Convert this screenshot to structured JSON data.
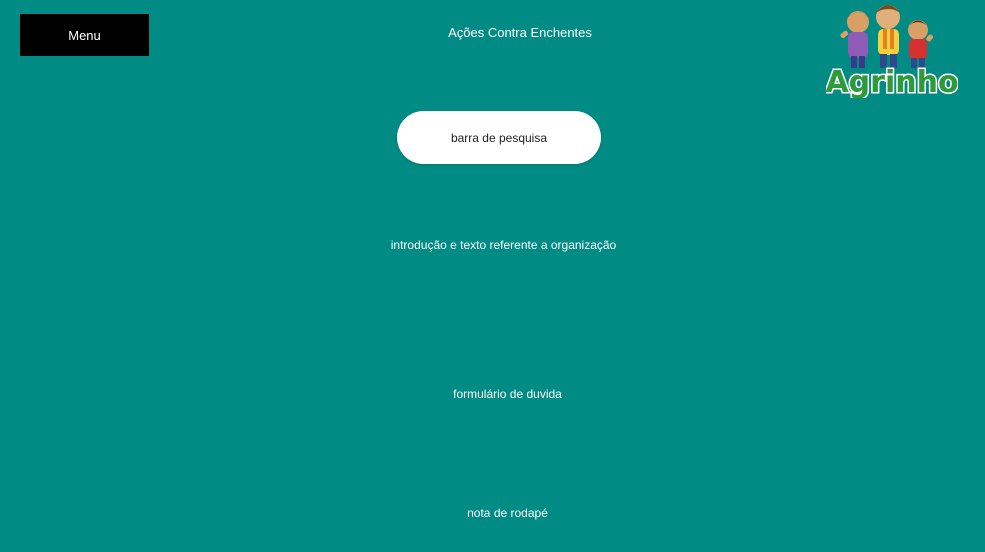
{
  "header": {
    "menu_label": "Menu",
    "title": "Ações Contra Enchentes",
    "logo_text": "Agrinho"
  },
  "search": {
    "placeholder": "barra de pesquisa"
  },
  "sections": {
    "intro": "introdução e texto referente a organização",
    "form": "formulário de duvida",
    "footer": "nota de rodapé"
  },
  "colors": {
    "background": "#008b84",
    "menu_bg": "#000000",
    "search_bg": "#ffffff",
    "logo_green": "#2f9a3a"
  },
  "icons": {
    "logo": "agrinho-logo-icon"
  }
}
